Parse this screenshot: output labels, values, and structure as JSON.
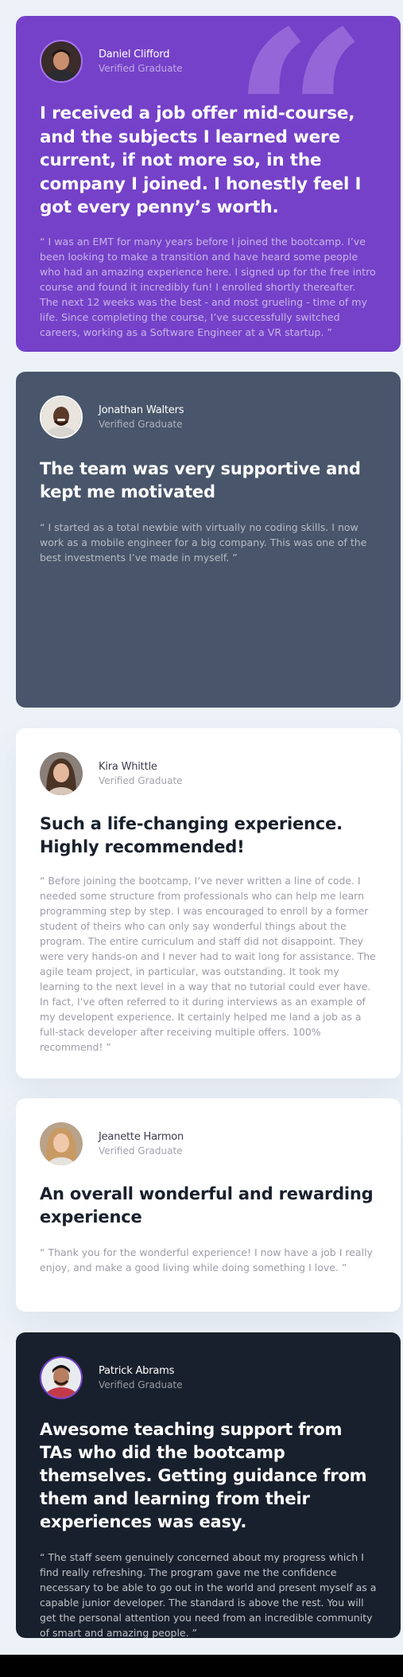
{
  "colors": {
    "page_background": "#ecf2f8",
    "purple": "#7541c8",
    "slate": "#48556a",
    "white": "#ffffff",
    "dark": "#19202d"
  },
  "testimonials": [
    {
      "name": "Daniel Clifford",
      "role": "Verified Graduate",
      "avatar_icon": "avatar-daniel",
      "headline": "I received a job offer mid-course, and the subjects I learned were current, if not more so, in the company I joined. I honestly feel I got every penny’s worth.",
      "body": "“ I was an EMT for many years before I joined the bootcamp. I’ve been looking to make a transition and have heard some people who had an amazing experience here. I signed up for the free intro course and found it incredibly fun! I enrolled shortly thereafter. The next 12 weeks was the best - and most grueling - time of my life. Since completing the course, I’ve successfully switched careers, working as a Software Engineer at a VR startup. ”"
    },
    {
      "name": "Jonathan Walters",
      "role": "Verified Graduate",
      "avatar_icon": "avatar-jonathan",
      "headline": "The team was very supportive and kept me motivated",
      "body": "“ I started as a total newbie with virtually no coding skills. I now work as a mobile engineer for a big company. This was one of the best investments I’ve made in myself. ”"
    },
    {
      "name": "Kira Whittle",
      "role": "Verified Graduate",
      "avatar_icon": "avatar-kira",
      "headline": "Such a life-changing experience. Highly recommended!",
      "body": "“ Before joining the bootcamp, I’ve never written a line of code. I needed some structure from professionals who can help me learn programming step by step. I was encouraged to enroll by a former student of theirs who can only say wonderful things about the program. The entire curriculum and staff did not disappoint. They were very hands-on and I never had to wait long for assistance. The agile team project, in particular, was outstanding. It took my learning to the next level in a way that no tutorial could ever have. In fact, I’ve often referred to it during interviews as an example of my developent experience. It certainly helped me land a job as a full-stack developer after receiving multiple offers. 100% recommend! ”"
    },
    {
      "name": "Jeanette Harmon",
      "role": "Verified Graduate",
      "avatar_icon": "avatar-jeanette",
      "headline": "An overall wonderful and rewarding experience",
      "body": "“ Thank you for the wonderful experience! I now have a job I really enjoy, and make a good living while doing something I love. ”"
    },
    {
      "name": "Patrick Abrams",
      "role": "Verified Graduate",
      "avatar_icon": "avatar-patrick",
      "headline": "Awesome teaching support from TAs who did the bootcamp themselves. Getting guidance from them and learning from their experiences was easy.",
      "body": "“ The staff seem genuinely concerned about my progress which I find really refreshing. The program gave me the confidence necessary to be able to go out in the world and present myself as a capable junior developer. The standard is above the rest. You will get the personal attention you need from an incredible community of smart and amazing people. ”"
    }
  ]
}
